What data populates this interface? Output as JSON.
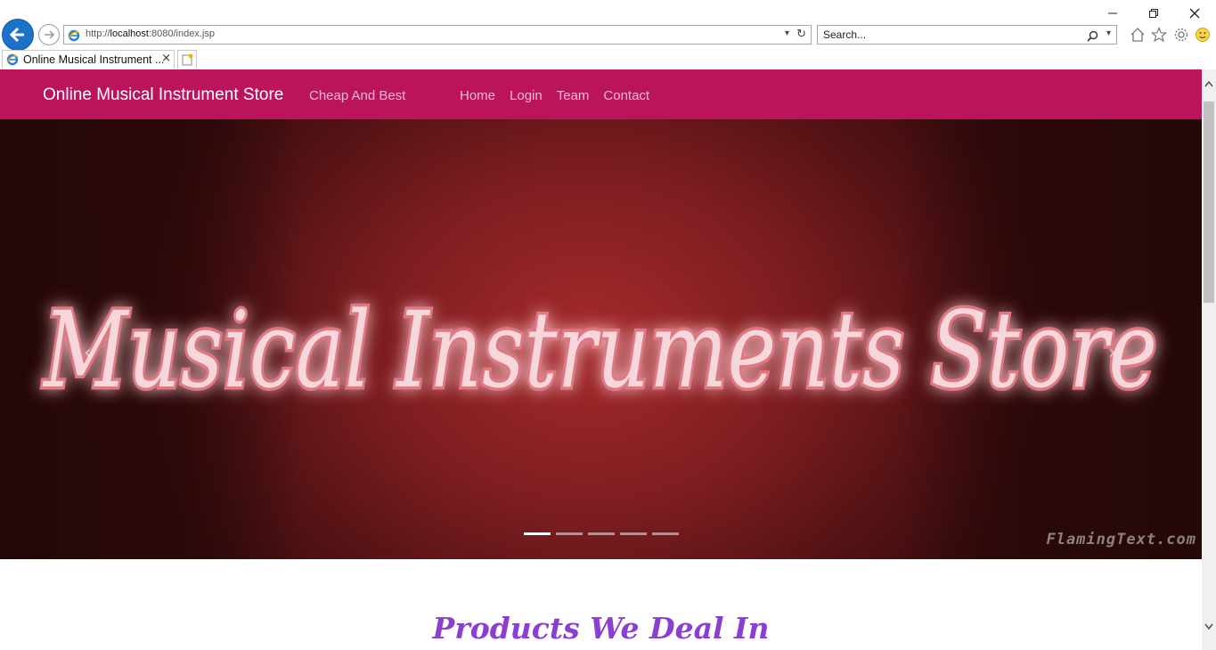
{
  "browser": {
    "address": {
      "scheme": "http://",
      "host": "localhost",
      "rest": ":8080/index.jsp"
    },
    "search_placeholder": "Search...",
    "tab_title": "Online Musical Instrument ...",
    "tab_close": "×"
  },
  "navbar": {
    "brand": "Online Musical Instrument Store",
    "tagline": "Cheap And Best",
    "links": [
      "Home",
      "Login",
      "Team",
      "Contact"
    ]
  },
  "carousel": {
    "banner_text": "Musical Instruments Store",
    "watermark": "FlamingText.com",
    "prev": "‹",
    "next": "›",
    "slide_count": 5,
    "active_slide": 1
  },
  "section": {
    "title": "Products We Deal In"
  },
  "colors": {
    "navbar": "#bc135d",
    "banner": "#a52a2c",
    "section_title": "#8a3fd0",
    "link": "#f2b9cf"
  }
}
